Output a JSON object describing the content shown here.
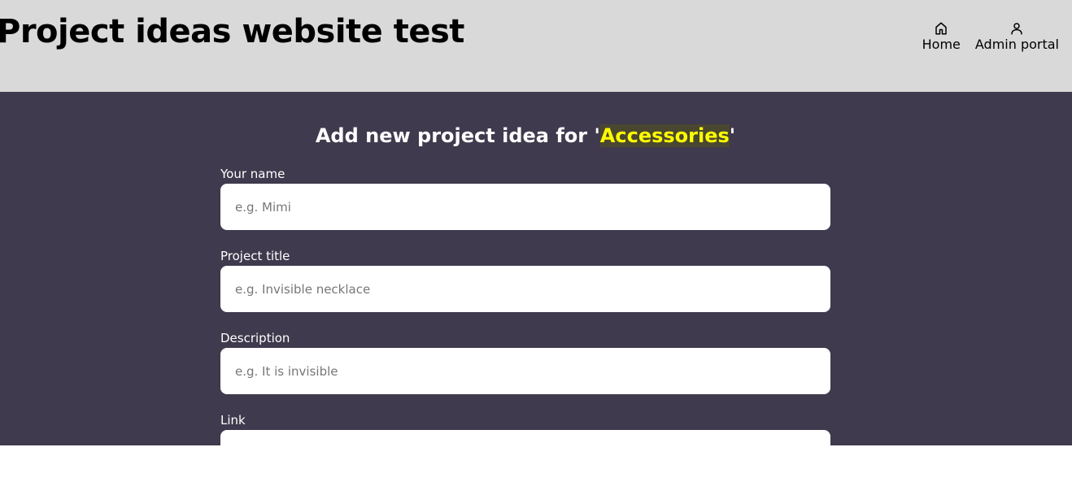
{
  "header": {
    "title": "Project ideas website test",
    "nav": [
      {
        "label": "Home",
        "icon": "home-icon"
      },
      {
        "label": "Admin portal",
        "icon": "user-icon"
      }
    ]
  },
  "form": {
    "heading_prefix": "Add new project idea for '",
    "category": "Accessories",
    "heading_suffix": "'",
    "fields": [
      {
        "label": "Your name",
        "placeholder": "e.g. Mimi",
        "value": ""
      },
      {
        "label": "Project title",
        "placeholder": "e.g. Invisible necklace",
        "value": ""
      },
      {
        "label": "Description",
        "placeholder": "e.g. It is invisible",
        "value": ""
      },
      {
        "label": "Link",
        "placeholder": "",
        "value": ""
      }
    ]
  },
  "colors": {
    "header_bg": "#d9d9d9",
    "main_bg": "#3f3a4d",
    "highlight": "#ffff00"
  }
}
